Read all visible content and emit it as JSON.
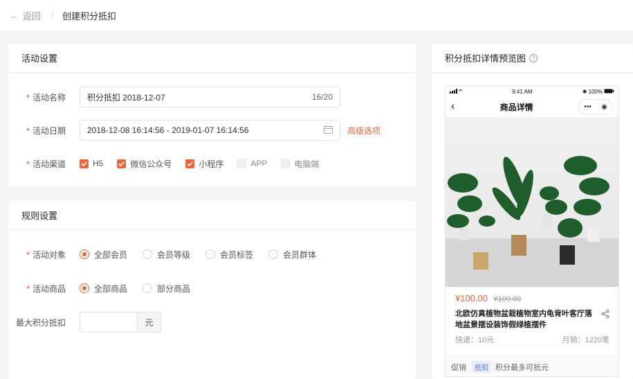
{
  "header": {
    "back_label": "返回",
    "title": "创建积分抵扣"
  },
  "activity": {
    "heading": "活动设置",
    "name_label": "活动名称",
    "name_value": "积分抵扣  2018-12-07",
    "name_count": "16/20",
    "date_label": "活动日期",
    "date_value": "2018-12-08 16:14:56 - 2019-01-07 16:14:56",
    "advanced_link": "高级选项",
    "channel_label": "活动渠道",
    "channels": [
      {
        "label": "H5",
        "checked": true
      },
      {
        "label": "微信公众号",
        "checked": true
      },
      {
        "label": "小程序",
        "checked": true
      },
      {
        "label": "APP",
        "checked": false
      },
      {
        "label": "电脑端",
        "checked": false
      }
    ]
  },
  "rules": {
    "heading": "规则设置",
    "target_label": "活动对象",
    "targets": [
      {
        "label": "全部会员",
        "selected": true
      },
      {
        "label": "会员等级",
        "selected": false
      },
      {
        "label": "会员标签",
        "selected": false
      },
      {
        "label": "会员群体",
        "selected": false
      }
    ],
    "goods_label": "活动商品",
    "goods": [
      {
        "label": "全部商品",
        "selected": true
      },
      {
        "label": "部分商品",
        "selected": false
      }
    ],
    "max_label": "最大积分抵扣",
    "max_value": "",
    "max_unit": "元"
  },
  "preview": {
    "heading": "积分抵扣详情预览图",
    "status_time": "9:41 AM",
    "status_battery": "100%",
    "nav_title": "商品详情",
    "price": "¥100.00",
    "original_price": "¥100.00",
    "product_name": "北欧仿真植物盆栽植物室内龟背叶客厅落地盆景摆设装饰假绿植摆件",
    "shipping": "快递：10元",
    "sales": "月销：1220笔",
    "promo_label": "促销",
    "promo_tag": "抵扣",
    "promo_text": "积分最多可抵元"
  },
  "colors": {
    "accent": "#f0643a",
    "required": "#e03c3c",
    "background": "#f3f4f6"
  }
}
